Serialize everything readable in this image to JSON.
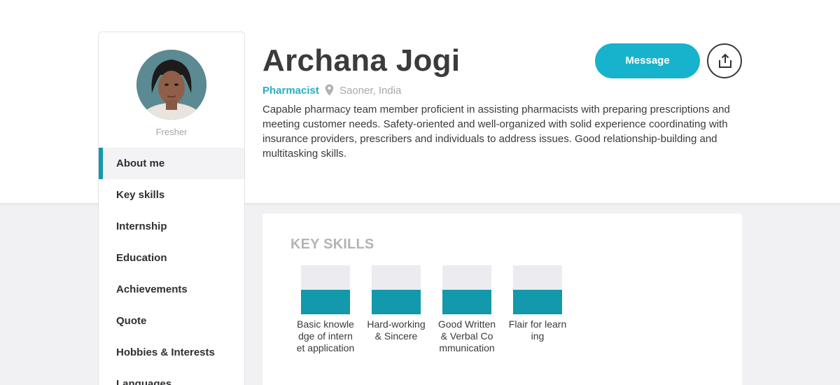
{
  "profile": {
    "name": "Archana Jogi",
    "role": "Pharmacist",
    "location": "Saoner, India",
    "status": "Fresher",
    "bio": "Capable pharmacy team member proficient in assisting pharmacists with preparing prescriptions and meeting customer needs. Safety-oriented and well-organized with solid experience coordinating with insurance providers, prescribers and individuals to address issues. Good relationship-building and multitasking skills."
  },
  "actions": {
    "message_label": "Message",
    "share_icon": "share-icon"
  },
  "sidebar": {
    "items": [
      {
        "label": "About me",
        "active": true
      },
      {
        "label": "Key skills"
      },
      {
        "label": "Internship"
      },
      {
        "label": "Education"
      },
      {
        "label": "Achievements"
      },
      {
        "label": "Quote"
      },
      {
        "label": "Hobbies & Interests"
      },
      {
        "label": "Languages"
      }
    ]
  },
  "key_skills": {
    "title": "KEY SKILLS",
    "skills": [
      {
        "label": "Basic knowledge of internet application",
        "level": 0.5
      },
      {
        "label": "Hard-working & Sincere",
        "level": 0.5
      },
      {
        "label": "Good Written & Verbal Communication",
        "level": 0.5
      },
      {
        "label": "Flair for learning",
        "level": 0.5
      }
    ]
  },
  "colors": {
    "accent": "#17b3cc",
    "skill_fill": "#1398ac",
    "role_text": "#29aec4"
  }
}
